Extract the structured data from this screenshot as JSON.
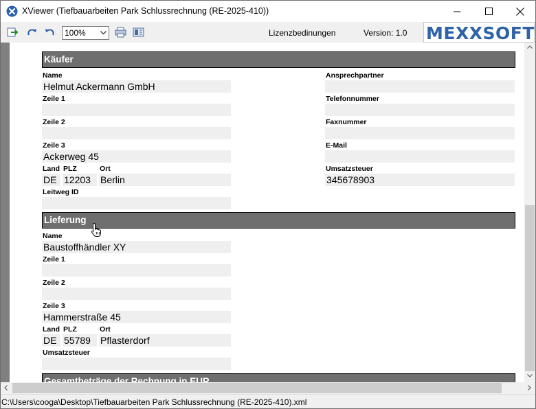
{
  "window": {
    "title": "XViewer (Tiefbauarbeiten Park Schlussrechnung (RE-2025-410))"
  },
  "toolbar": {
    "icons": [
      "export-icon",
      "redo-icon",
      "undo-icon",
      "print-icon",
      "view-icon"
    ],
    "zoom": "100%",
    "license_link": "Lizenzbedinungen",
    "version": "Version: 1.0",
    "logo": "MEXXSOFT"
  },
  "kaeufer": {
    "header": "Käufer",
    "name_label": "Name",
    "name": "Helmut Ackermann GmbH",
    "zeile1_label": "Zeile 1",
    "zeile1": "",
    "zeile2_label": "Zeile 2",
    "zeile2": "",
    "zeile3_label": "Zeile 3",
    "zeile3": "Ackerweg 45",
    "land_label": "Land",
    "land": "DE",
    "plz_label": "PLZ",
    "plz": "12203",
    "ort_label": "Ort",
    "ort": "Berlin",
    "leitweg_label": "Leitweg ID",
    "leitweg": "",
    "ansprechpartner_label": "Ansprechpartner",
    "ansprechpartner": "",
    "telefon_label": "Telefonnummer",
    "telefon": "",
    "fax_label": "Faxnummer",
    "fax": "",
    "email_label": "E-Mail",
    "email": "",
    "ust_label": "Umsatzsteuer",
    "ust": "345678903"
  },
  "lieferung": {
    "header": "Lieferung",
    "name_label": "Name",
    "name": "Baustoffhändler XY",
    "zeile1_label": "Zeile 1",
    "zeile1": "",
    "zeile2_label": "Zeile 2",
    "zeile2": "",
    "zeile3_label": "Zeile 3",
    "zeile3": "Hammerstraße 45",
    "land_label": "Land",
    "land": "DE",
    "plz_label": "PLZ",
    "plz": "55789",
    "ort_label": "Ort",
    "ort": "Pflasterdorf",
    "ust_label": "Umsatzsteuer",
    "ust": ""
  },
  "gesamt": {
    "header": "Gesamtbeträge der Rechnung in EUR"
  },
  "status": {
    "path": "C:\\Users\\cooga\\Desktop\\Tiefbauarbeiten Park Schlussrechnung (RE-2025-410).xml"
  },
  "colors": {
    "header_bg": "#6f6f6f",
    "field_bg": "#efefef",
    "logo": "#2f63a9"
  }
}
